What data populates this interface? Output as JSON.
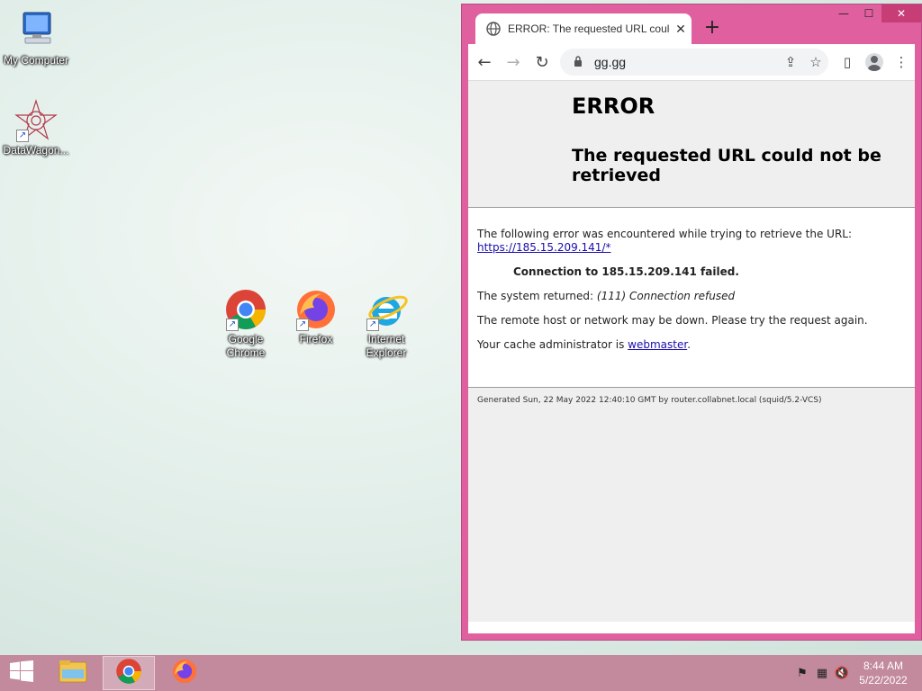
{
  "desktop": {
    "icons": [
      {
        "label": "My Computer"
      },
      {
        "label": "DataWagon..."
      },
      {
        "label": "Google Chrome"
      },
      {
        "label": "Firefox"
      },
      {
        "label": "Internet Explorer"
      }
    ]
  },
  "browser": {
    "tab_title": "ERROR: The requested URL could not be retrieved",
    "new_tab_label": "+",
    "url": "gg.gg"
  },
  "page": {
    "heading": "ERROR",
    "subheading": "The requested URL could not be retrieved",
    "intro": "The following error was encountered while trying to retrieve the URL:",
    "failed_url": "https://185.15.209.141/*",
    "connection_failed": "Connection to 185.15.209.141 failed.",
    "system_returned_label": "The system returned:",
    "system_returned_value": "(111) Connection refused",
    "remote_down": "The remote host or network may be down. Please try the request again.",
    "cache_admin_prefix": "Your cache administrator is",
    "cache_admin_link": "webmaster",
    "cache_admin_suffix": ".",
    "generated": "Generated Sun, 22 May 2022 12:40:10 GMT by router.collabnet.local (squid/5.2-VCS)"
  },
  "taskbar": {
    "time": "8:44 AM",
    "date": "5/22/2022"
  }
}
